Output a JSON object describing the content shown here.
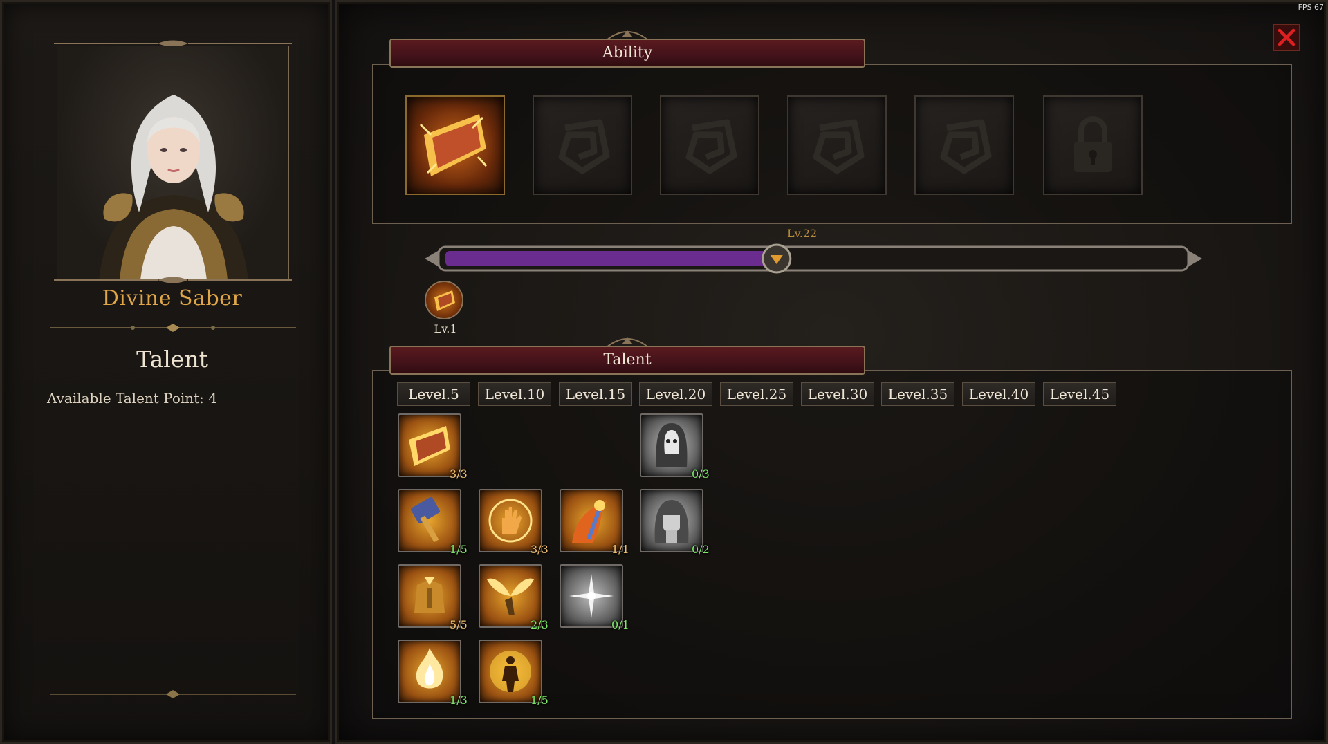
{
  "hud": {
    "fps": "FPS 67"
  },
  "character": {
    "name": "Divine Saber",
    "talent_heading": "Talent",
    "talent_points": "Available Talent Point: 4"
  },
  "ability": {
    "title": "Ability",
    "slots": [
      {
        "state": "equipped",
        "icon": "crystal-shield-icon"
      },
      {
        "state": "empty",
        "icon": "spiral-emblem-icon"
      },
      {
        "state": "empty",
        "icon": "spiral-emblem-icon"
      },
      {
        "state": "empty",
        "icon": "spiral-emblem-icon"
      },
      {
        "state": "empty",
        "icon": "spiral-emblem-icon"
      },
      {
        "state": "locked",
        "icon": "lock-icon"
      }
    ],
    "xp_level": "Lv.22",
    "xp_progress": 0.45,
    "current_ability_level": "Lv.1"
  },
  "talent": {
    "title": "Talent",
    "levels": [
      "Level.5",
      "Level.10",
      "Level.15",
      "Level.20",
      "Level.25",
      "Level.30",
      "Level.35",
      "Level.40",
      "Level.45"
    ],
    "nodes": [
      {
        "icon": "crystal-shield-icon",
        "count": "3/3",
        "style": "gold",
        "status": "max"
      },
      {
        "icon": "hooded-mask-icon",
        "count": "0/3",
        "style": "grey",
        "status": "partial"
      },
      {
        "icon": "holy-hammer-icon",
        "count": "1/5",
        "style": "gold",
        "status": "partial"
      },
      {
        "icon": "radiant-palm-icon",
        "count": "3/3",
        "style": "gold",
        "status": "max"
      },
      {
        "icon": "flaming-scepter-icon",
        "count": "1/1",
        "style": "gold",
        "status": "max"
      },
      {
        "icon": "raised-fist-icon",
        "count": "0/2",
        "style": "grey",
        "status": "partial"
      },
      {
        "icon": "golden-armor-icon",
        "count": "5/5",
        "style": "gold",
        "status": "max"
      },
      {
        "icon": "winged-strike-icon",
        "count": "2/3",
        "style": "gold",
        "status": "partial"
      },
      {
        "icon": "starburst-icon",
        "count": "0/1",
        "style": "grey",
        "status": "partial"
      },
      {
        "icon": "holy-flame-icon",
        "count": "1/3",
        "style": "gold",
        "status": "partial"
      },
      {
        "icon": "golden-aura-icon",
        "count": "1/5",
        "style": "gold",
        "status": "partial"
      }
    ]
  },
  "colors": {
    "accent_gold": "#e0a648",
    "xp_purple": "#6a2c8e",
    "banner_red": "#4a141a",
    "count_max": "#f0c070",
    "count_partial": "#7ee86a",
    "close_red": "#e02020"
  }
}
